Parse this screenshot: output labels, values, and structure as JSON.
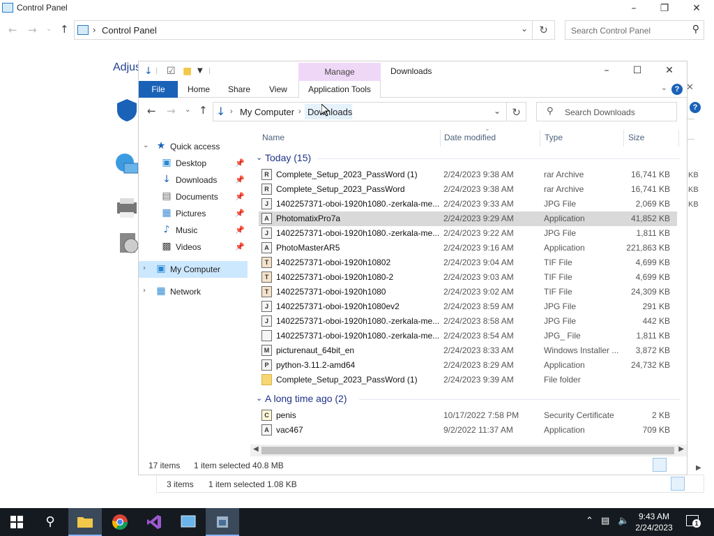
{
  "background_window": {
    "title": "Control Panel",
    "address": "Control Panel",
    "search_placeholder": "Search Control Panel",
    "heading": "Adjus",
    "status": {
      "items": "3 items",
      "selected": "1 item selected  1.08 KB"
    },
    "stub_sizes": [
      "KB",
      "KB",
      "KB"
    ]
  },
  "explorer": {
    "title": "Downloads",
    "manage_tab": "Manage",
    "ribbon_tabs": {
      "file": "File",
      "home": "Home",
      "share": "Share",
      "view": "View",
      "app_tools": "Application Tools"
    },
    "address": {
      "root": "My Computer",
      "current": "Downloads"
    },
    "search_placeholder": "Search Downloads",
    "nav": {
      "quick_access": "Quick access",
      "items": [
        {
          "label": "Desktop",
          "icon": "desktop-icon"
        },
        {
          "label": "Downloads",
          "icon": "downloads-icon"
        },
        {
          "label": "Documents",
          "icon": "documents-icon"
        },
        {
          "label": "Pictures",
          "icon": "pictures-icon"
        },
        {
          "label": "Music",
          "icon": "music-icon"
        },
        {
          "label": "Videos",
          "icon": "videos-icon"
        }
      ],
      "my_computer": "My Computer",
      "network": "Network"
    },
    "columns": {
      "name": "Name",
      "date": "Date modified",
      "type": "Type",
      "size": "Size"
    },
    "groups": [
      {
        "label": "Today (15)",
        "files": [
          {
            "name": "Complete_Setup_2023_PassWord (1)",
            "date": "2/24/2023 9:38 AM",
            "type": "rar Archive",
            "size": "16,741 KB",
            "icon": "R"
          },
          {
            "name": "Complete_Setup_2023_PassWord",
            "date": "2/24/2023 9:38 AM",
            "type": "rar Archive",
            "size": "16,741 KB",
            "icon": "R"
          },
          {
            "name": "1402257371-oboi-1920h1080.-zerkala-me...",
            "date": "2/24/2023 9:33 AM",
            "type": "JPG File",
            "size": "2,069 KB",
            "icon": "J"
          },
          {
            "name": "PhotomatixPro7a",
            "date": "2/24/2023 9:29 AM",
            "type": "Application",
            "size": "41,852 KB",
            "icon": "A",
            "selected": true
          },
          {
            "name": "1402257371-oboi-1920h1080.-zerkala-me...",
            "date": "2/24/2023 9:22 AM",
            "type": "JPG File",
            "size": "1,811 KB",
            "icon": "J"
          },
          {
            "name": "PhotoMasterAR5",
            "date": "2/24/2023 9:16 AM",
            "type": "Application",
            "size": "221,863 KB",
            "icon": "A"
          },
          {
            "name": "1402257371-oboi-1920h10802",
            "date": "2/24/2023 9:04 AM",
            "type": "TIF File",
            "size": "4,699 KB",
            "icon": "T"
          },
          {
            "name": "1402257371-oboi-1920h1080-2",
            "date": "2/24/2023 9:03 AM",
            "type": "TIF File",
            "size": "4,699 KB",
            "icon": "T"
          },
          {
            "name": "1402257371-oboi-1920h1080",
            "date": "2/24/2023 9:02 AM",
            "type": "TIF File",
            "size": "24,309 KB",
            "icon": "T"
          },
          {
            "name": "1402257371-oboi-1920h1080ev2",
            "date": "2/24/2023 8:59 AM",
            "type": "JPG File",
            "size": "291 KB",
            "icon": "J"
          },
          {
            "name": "1402257371-oboi-1920h1080.-zerkala-me...",
            "date": "2/24/2023 8:58 AM",
            "type": "JPG File",
            "size": "442 KB",
            "icon": "J"
          },
          {
            "name": "1402257371-oboi-1920h1080.-zerkala-me...",
            "date": "2/24/2023 8:54 AM",
            "type": "JPG_ File",
            "size": "1,811 KB",
            "icon": ""
          },
          {
            "name": "picturenaut_64bit_en",
            "date": "2/24/2023 8:33 AM",
            "type": "Windows Installer ...",
            "size": "3,872 KB",
            "icon": "M"
          },
          {
            "name": "python-3.11.2-amd64",
            "date": "2/24/2023 8:29 AM",
            "type": "Application",
            "size": "24,732 KB",
            "icon": "P"
          },
          {
            "name": "Complete_Setup_2023_PassWord (1)",
            "date": "2/24/2023 9:39 AM",
            "type": "File folder",
            "size": "",
            "icon": "F"
          }
        ]
      },
      {
        "label": "A long time ago (2)",
        "files": [
          {
            "name": "penis",
            "date": "10/17/2022 7:58 PM",
            "type": "Security Certificate",
            "size": "2 KB",
            "icon": "C"
          },
          {
            "name": "vac467",
            "date": "9/2/2022 11:37 AM",
            "type": "Application",
            "size": "709 KB",
            "icon": "A"
          }
        ]
      }
    ],
    "status": {
      "items": "17 items",
      "selected": "1 item selected  40.8 MB"
    }
  },
  "taskbar": {
    "time": "9:43 AM",
    "date": "2/24/2023",
    "notification_count": "1"
  },
  "colors": {
    "accent": "#1a62b8",
    "manage_tab": "#efd8f7",
    "group_header": "#1e3287",
    "selection": "#cce8ff",
    "taskbar": "#151a20"
  }
}
